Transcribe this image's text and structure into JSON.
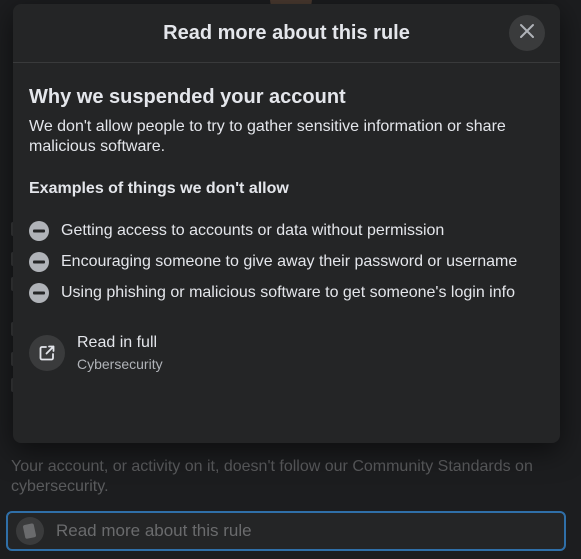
{
  "modal": {
    "title": "Read more about this rule",
    "close_icon": "close-icon",
    "section_title": "Why we suspended your account",
    "section_desc": "We don't allow people to try to gather sensitive information or share malicious software.",
    "examples_title": "Examples of things we don't allow",
    "example_icon": "minus-circle-icon",
    "examples": [
      {
        "text": "Getting access to accounts or data without permission"
      },
      {
        "text": "Encouraging someone to give away their password or username"
      },
      {
        "text": "Using phishing or malicious software to get someone's login info"
      }
    ],
    "read_full": {
      "icon": "external-link-icon",
      "title": "Read in full",
      "subtitle": "Cybersecurity"
    }
  },
  "background": {
    "body_text": "Your account, or activity on it, doesn't follow our Community Standards on cybersecurity.",
    "button_label": "Read more about this rule"
  },
  "colors": {
    "modal_bg": "#242526",
    "text_primary": "#e4e6eb",
    "text_secondary": "#b0b3b8",
    "icon_bg": "#3a3b3c",
    "focus_ring": "#2f6fa8"
  }
}
